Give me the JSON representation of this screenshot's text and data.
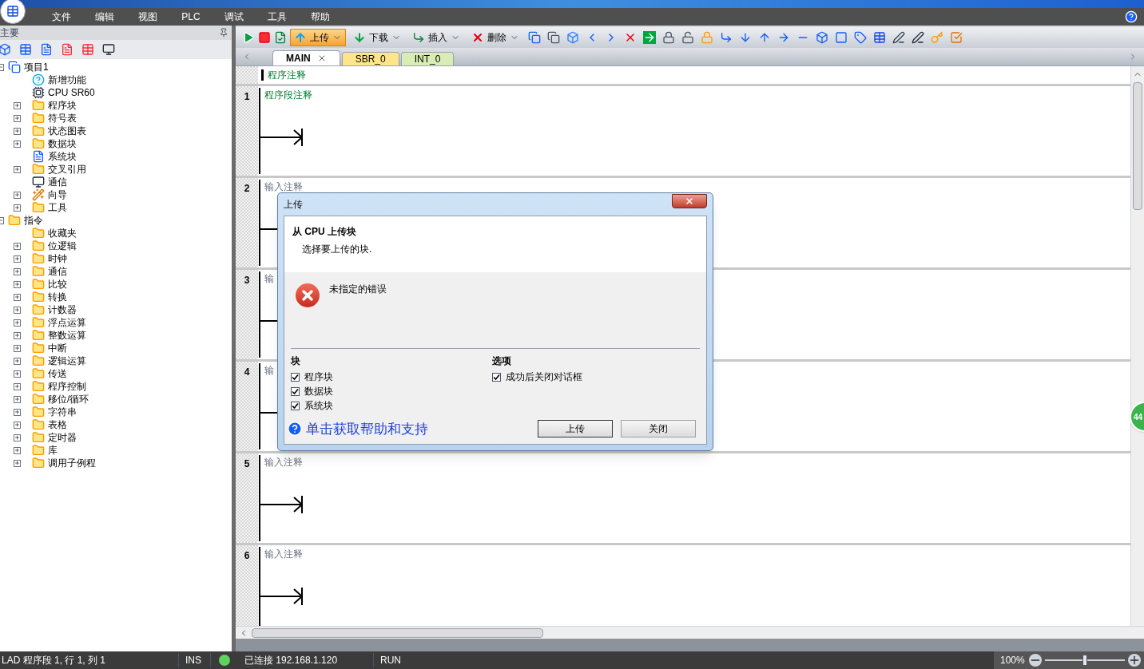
{
  "menu": [
    "文件",
    "编辑",
    "视图",
    "PLC",
    "调试",
    "工具",
    "帮助"
  ],
  "left_panel": {
    "title": "主要",
    "tree": [
      {
        "label": "项目1",
        "kind": "project",
        "expanded": true,
        "children": [
          {
            "label": "新增功能",
            "kind": "help"
          },
          {
            "label": "CPU SR60",
            "kind": "cpu"
          },
          {
            "label": "程序块",
            "kind": "folder",
            "expanded": false
          },
          {
            "label": "符号表",
            "kind": "folder",
            "expanded": false
          },
          {
            "label": "状态图表",
            "kind": "folder",
            "expanded": false
          },
          {
            "label": "数据块",
            "kind": "folder",
            "expanded": false
          },
          {
            "label": "系统块",
            "kind": "document"
          },
          {
            "label": "交叉引用",
            "kind": "folder",
            "expanded": false
          },
          {
            "label": "通信",
            "kind": "monitor"
          },
          {
            "label": "向导",
            "kind": "wizard",
            "expanded": false
          },
          {
            "label": "工具",
            "kind": "folder",
            "expanded": false
          }
        ]
      },
      {
        "label": "指令",
        "kind": "folder",
        "expanded": true,
        "children": [
          {
            "label": "收藏夹",
            "kind": "folder"
          },
          {
            "label": "位逻辑",
            "kind": "folder",
            "expanded": false
          },
          {
            "label": "时钟",
            "kind": "folder",
            "expanded": false
          },
          {
            "label": "通信",
            "kind": "folder",
            "expanded": false
          },
          {
            "label": "比较",
            "kind": "folder",
            "expanded": false
          },
          {
            "label": "转换",
            "kind": "folder",
            "expanded": false
          },
          {
            "label": "计数器",
            "kind": "folder",
            "expanded": false
          },
          {
            "label": "浮点运算",
            "kind": "folder",
            "expanded": false
          },
          {
            "label": "整数运算",
            "kind": "folder",
            "expanded": false
          },
          {
            "label": "中断",
            "kind": "folder",
            "expanded": false
          },
          {
            "label": "逻辑运算",
            "kind": "folder",
            "expanded": false
          },
          {
            "label": "传送",
            "kind": "folder",
            "expanded": false
          },
          {
            "label": "程序控制",
            "kind": "folder",
            "expanded": false
          },
          {
            "label": "移位/循环",
            "kind": "folder",
            "expanded": false
          },
          {
            "label": "字符串",
            "kind": "folder",
            "expanded": false
          },
          {
            "label": "表格",
            "kind": "folder",
            "expanded": false
          },
          {
            "label": "定时器",
            "kind": "folder",
            "expanded": false
          },
          {
            "label": "库",
            "kind": "folder",
            "expanded": false
          },
          {
            "label": "调用子例程",
            "kind": "folder",
            "expanded": false
          }
        ]
      }
    ]
  },
  "toolbar": [
    {
      "label": "上传",
      "kind": "upload",
      "selected": true
    },
    {
      "label": "下载",
      "kind": "download",
      "selected": false
    },
    {
      "label": "插入",
      "kind": "insert",
      "selected": false
    },
    {
      "label": "删除",
      "kind": "delete",
      "selected": false
    }
  ],
  "tabs": [
    {
      "label": "MAIN",
      "selected": true,
      "color": "#ffffff"
    },
    {
      "label": "SBR_0",
      "selected": false,
      "color": "#fde68a"
    },
    {
      "label": "INT_0",
      "selected": false,
      "color": "#d9ecb5"
    }
  ],
  "editor": {
    "program_comment": "程序注释",
    "networks": [
      {
        "number": "1",
        "comment": "程序段注释",
        "kind": "comment"
      },
      {
        "number": "2",
        "comment": "输入注释",
        "kind": "placeholder"
      },
      {
        "number": "3",
        "comment": "输",
        "kind": "placeholder"
      },
      {
        "number": "4",
        "comment": "输",
        "kind": "placeholder"
      },
      {
        "number": "5",
        "comment": "输入注释",
        "kind": "placeholder"
      },
      {
        "number": "6",
        "comment": "输入注释",
        "kind": "placeholder"
      }
    ]
  },
  "dialog": {
    "title": "上传",
    "heading": "从 CPU 上传块",
    "subtitle": "选择要上传的块.",
    "error": "未指定的错误",
    "blocks": {
      "title": "块",
      "items": [
        {
          "label": "程序块",
          "checked": true
        },
        {
          "label": "数据块",
          "checked": true
        },
        {
          "label": "系统块",
          "checked": true
        }
      ]
    },
    "options": {
      "title": "选项",
      "items": [
        {
          "label": "成功后关闭对话框",
          "checked": true
        }
      ]
    },
    "help_link": "单击获取帮助和支持",
    "buttons": [
      "上传",
      "关闭"
    ]
  },
  "side_badge": "44",
  "status_bar": {
    "position": "LAD 程序段 1, 行 1, 列 1",
    "mode": "INS",
    "connected": true,
    "connection": "已连接 192.168.1.120",
    "state": "RUN",
    "zoom": "100%",
    "zoom_level": {
      "level": 0.5
    }
  }
}
